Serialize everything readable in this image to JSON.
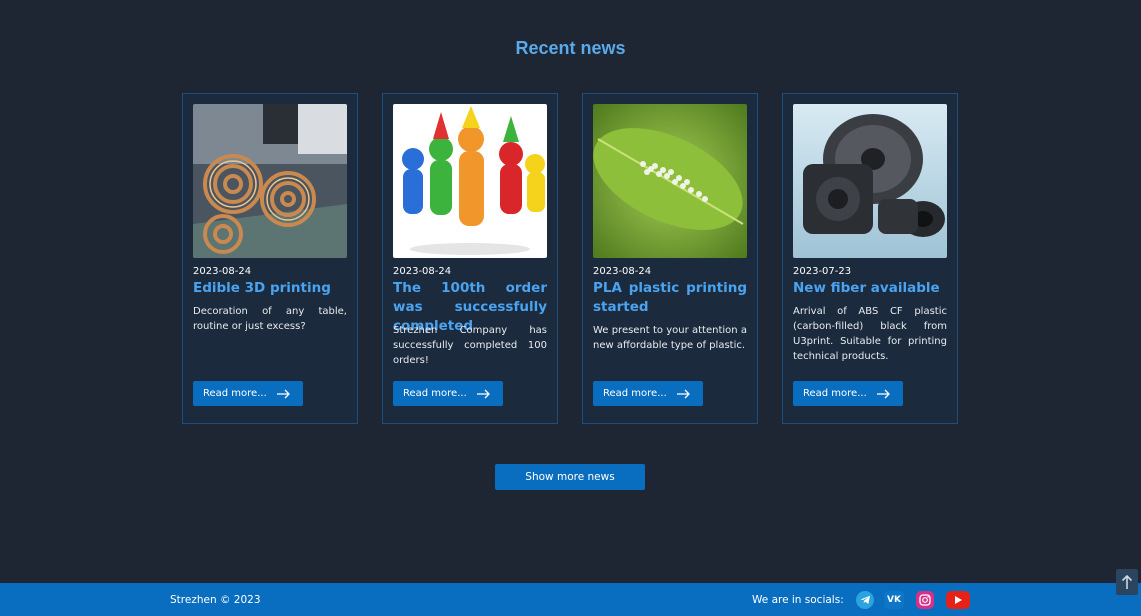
{
  "section": {
    "title": "Recent news"
  },
  "cards": [
    {
      "date": "2023-08-24",
      "title": "Edible 3D printing",
      "text": "Decoration of any table, routine or just excess?",
      "button": "Read more...",
      "image": "3d-printed-cookies-image"
    },
    {
      "date": "2023-08-24",
      "title": "The 100th order was successfully completed",
      "text": "Strezhen Company has successfully completed 100 orders!",
      "button": "Read more...",
      "image": "party-figures-image"
    },
    {
      "date": "2023-08-24",
      "title": "PLA plastic printing started",
      "text": "We present to your attention a new affordable type of plastic.",
      "button": "Read more...",
      "image": "leaf-with-pellets-image"
    },
    {
      "date": "2023-07-23",
      "title": "New fiber available",
      "text": "Arrival of ABS CF plastic (carbon-filled) black from U3print. Suitable for printing technical products.",
      "button": "Read more...",
      "image": "black-spool-parts-image"
    }
  ],
  "show_more": "Show more news",
  "footer": {
    "copyright": "Strezhen © 2023",
    "socials_label": "We are in socials:",
    "socials": [
      "telegram-icon",
      "vk-icon",
      "instagram-icon",
      "youtube-icon"
    ]
  },
  "colors": {
    "background": "#1e2533",
    "accent": "#0a6ec0",
    "title": "#5aa9ea",
    "card_title": "#4aa3f0"
  }
}
